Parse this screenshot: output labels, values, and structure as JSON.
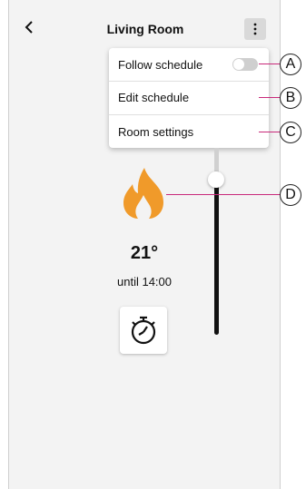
{
  "header": {
    "title": "Living Room",
    "back_icon": "chevron-left-icon",
    "more_icon": "kebab-icon"
  },
  "menu": {
    "items": [
      {
        "label": "Follow schedule",
        "toggle_on": false
      },
      {
        "label": "Edit schedule"
      },
      {
        "label": "Room settings"
      }
    ]
  },
  "status": {
    "temperature": "21°",
    "until": "until 14:00"
  },
  "icons": {
    "heating": "flame-icon",
    "timer": "stopwatch-icon"
  },
  "callouts": [
    "A",
    "B",
    "C",
    "D"
  ],
  "colors": {
    "flame": "#f09a2a",
    "callout_line": "#c8297a",
    "track": "#111111"
  }
}
